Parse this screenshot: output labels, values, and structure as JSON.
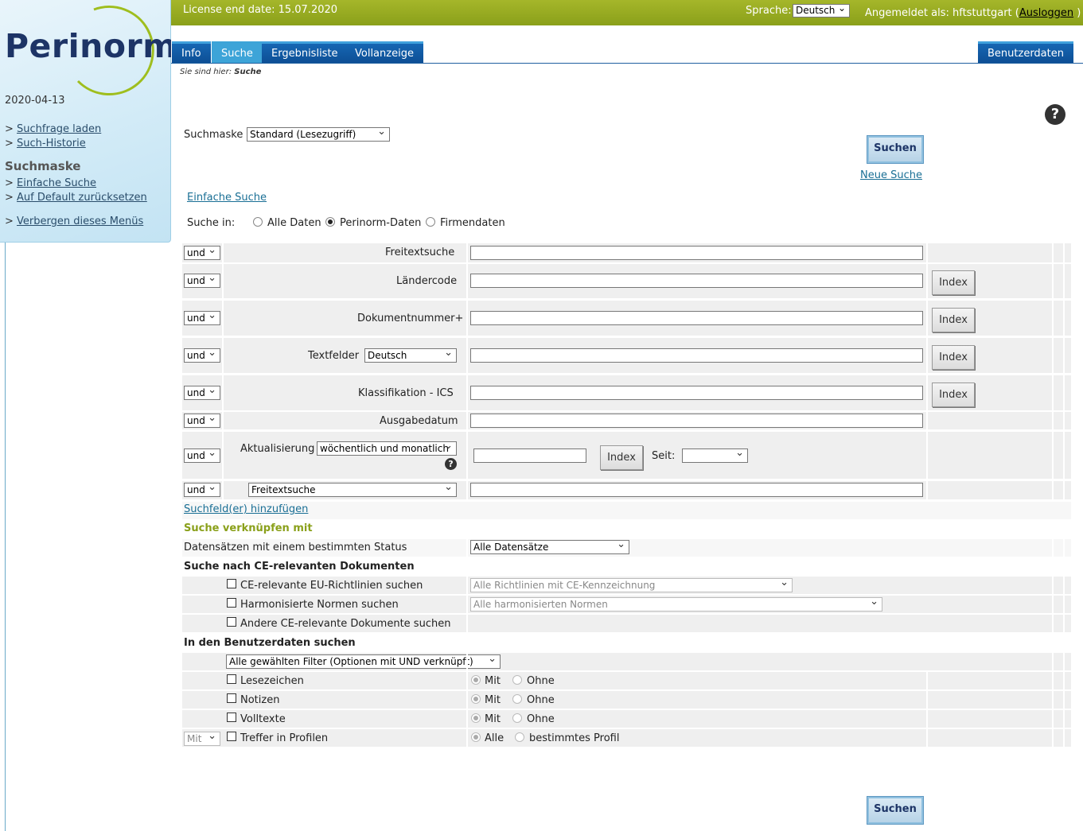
{
  "sidebar": {
    "logo": "Perinorm",
    "date": "2020-04-13",
    "links": [
      {
        "prefix": "> ",
        "label": "Suchfrage laden"
      },
      {
        "prefix": "> ",
        "label": "Such-Historie"
      }
    ],
    "heading": "Suchmaske",
    "mask_links": [
      {
        "prefix": "> ",
        "label": "Einfache Suche"
      },
      {
        "prefix": "> ",
        "label": "Auf Default zurücksetzen"
      }
    ],
    "hide_menu": {
      "prefix": "> ",
      "label": "Verbergen dieses Menüs"
    }
  },
  "topbar": {
    "license": "License end date: 15.07.2020",
    "language_label": "Sprache:",
    "language_value": "Deutsch",
    "logged_in_prefix": "Angemeldet als: hftstuttgart",
    "logout_open": " (",
    "logout_label": "Ausloggen",
    "logout_close": " )"
  },
  "tabs": [
    "Info",
    "Suche",
    "Ergebnisliste",
    "Vollanzeige"
  ],
  "active_tab": "Suche",
  "user_tab": "Benutzerdaten",
  "breadcrumb": {
    "prefix": "Sie sind hier: ",
    "current": "Suche"
  },
  "colors": {
    "topbar": "#8aa01a",
    "tab": "#0d4f95",
    "tab_active": "#3da4d8",
    "accent_green": "#8aa01a"
  },
  "form": {
    "mask_label": "Suchmaske",
    "mask_value": "Standard (Lesezugriff)",
    "search_button": "Suchen",
    "new_search": "Neue Suche",
    "simple_search": "Einfache Suche",
    "search_in_label": "Suche in:",
    "search_in_options": [
      "Alle Daten",
      "Perinorm-Daten",
      "Firmendaten"
    ],
    "search_in_selected": "Perinorm-Daten",
    "operator": "und",
    "index_button": "Index",
    "rows": [
      {
        "label": "Freitextsuche"
      },
      {
        "label": "Ländercode"
      },
      {
        "label": "Dokumentnummer+"
      },
      {
        "label": "Textfelder",
        "select": "Deutsch"
      },
      {
        "label": "Klassifikation - ICS"
      },
      {
        "label": "Ausgabedatum"
      },
      {
        "label": "Aktualisierung",
        "select": "wöchentlich und monatlich",
        "since_label": "Seit:",
        "since_value": ""
      },
      {
        "select": "Freitextsuche"
      }
    ],
    "add_fields": "Suchfeld(er) hinzufügen",
    "link_heading": "Suche verknüpfen mit",
    "status_label": "Datensätzen mit einem bestimmten Status",
    "status_value": "Alle Datensätze",
    "ce_heading": "Suche nach CE-relevanten Dokumenten",
    "ce_items": [
      {
        "label": "CE-relevante EU-Richtlinien suchen",
        "select": "Alle Richtlinien mit CE-Kennzeichnung"
      },
      {
        "label": "Harmonisierte Normen suchen",
        "select": "Alle harmonisierten Normen"
      },
      {
        "label": "Andere CE-relevante Dokumente suchen"
      }
    ],
    "user_heading": "In den Benutzerdaten suchen",
    "user_filter": "Alle gewählten Filter (Optionen mit UND verknüpft)",
    "user_items": [
      {
        "label": "Lesezeichen",
        "opt1": "Mit",
        "opt2": "Ohne"
      },
      {
        "label": "Notizen",
        "opt1": "Mit",
        "opt2": "Ohne"
      },
      {
        "label": "Volltexte",
        "opt1": "Mit",
        "opt2": "Ohne"
      },
      {
        "label": "Treffer in Profilen",
        "opt1": "Alle",
        "opt2": "bestimmtes Profil",
        "pre_select": "Mit"
      }
    ]
  }
}
